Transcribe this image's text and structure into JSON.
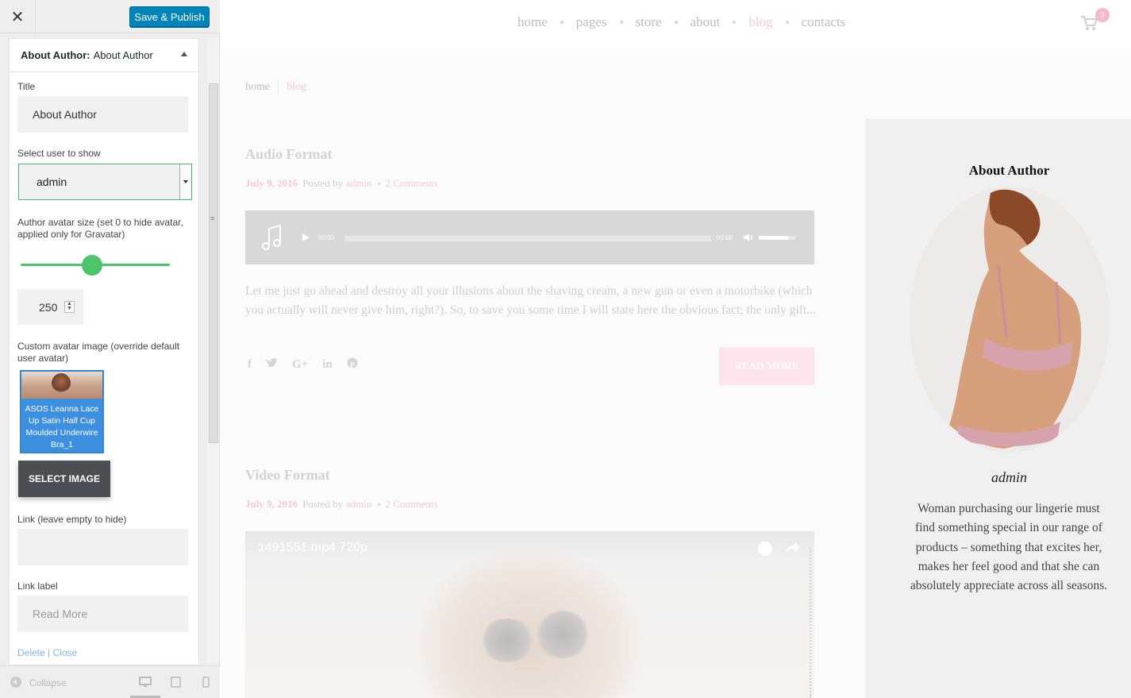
{
  "customizer": {
    "save_label": "Save & Publish",
    "widget_header_bold": "About Author:",
    "widget_header_name": "About Author",
    "title_label": "Title",
    "title_value": "About Author",
    "select_user_label": "Select user to show",
    "select_user_value": "admin",
    "avatar_size_label": "Author avatar size (set 0 to hide avatar, applied only for Gravatar)",
    "avatar_size_value": "250",
    "avatar_size_slider_fraction": 0.48,
    "custom_avatar_label": "Custom avatar image (override default user avatar)",
    "avatar_caption": "ASOS Leanna Lace Up Satin Half Cup Moulded Underwire Bra_1",
    "select_image_label": "SELECT IMAGE",
    "link_label": "Link (leave empty to hide)",
    "link_value": "",
    "link_label_label": "Link label",
    "link_label_placeholder": "Read More",
    "delete_label": "Delete",
    "close_label": "Close",
    "collapse_label": "Collapse"
  },
  "site": {
    "nav": [
      "home",
      "pages",
      "store",
      "about",
      "blog",
      "contacts"
    ],
    "nav_active": "blog",
    "cart_count": "0",
    "breadcrumb": {
      "home": "home",
      "current": "blog"
    },
    "posts": [
      {
        "title": "Audio Format",
        "date": "July 9, 2016",
        "posted_by": "Posted by",
        "author": "admin",
        "comments": "2 Comments",
        "audio_time_start": "00:00",
        "audio_time_end": "00:00",
        "audio_volume_fraction": 0.8,
        "excerpt": "Let me just go ahead and destroy all your illusions about the shaving cream, a new gun or even a motorbike (which you actually will never give him, right?). So, to save you some time I will state here the obvious fact; the only gift...",
        "read_more": "READ MORE"
      },
      {
        "title": "Video Format",
        "date": "July 9, 2016",
        "posted_by": "Posted by",
        "author": "admin",
        "comments": "2 Comments",
        "video_title": "1491551.mp4 720p"
      }
    ],
    "share_icons": [
      "facebook-icon",
      "twitter-icon",
      "google-plus-icon",
      "linkedin-icon",
      "pinterest-icon"
    ],
    "about_widget": {
      "title": "About Author",
      "name": "admin",
      "bio": "Woman purchasing our lingerie must find something special in our range of products – something that excites her, makes her feel good and that she can absolutely appreciate across all seasons."
    }
  },
  "colors": {
    "accent_blue": "#0085ba",
    "slider_green": "#4cc46c",
    "site_pink": "#f4c8d8"
  }
}
